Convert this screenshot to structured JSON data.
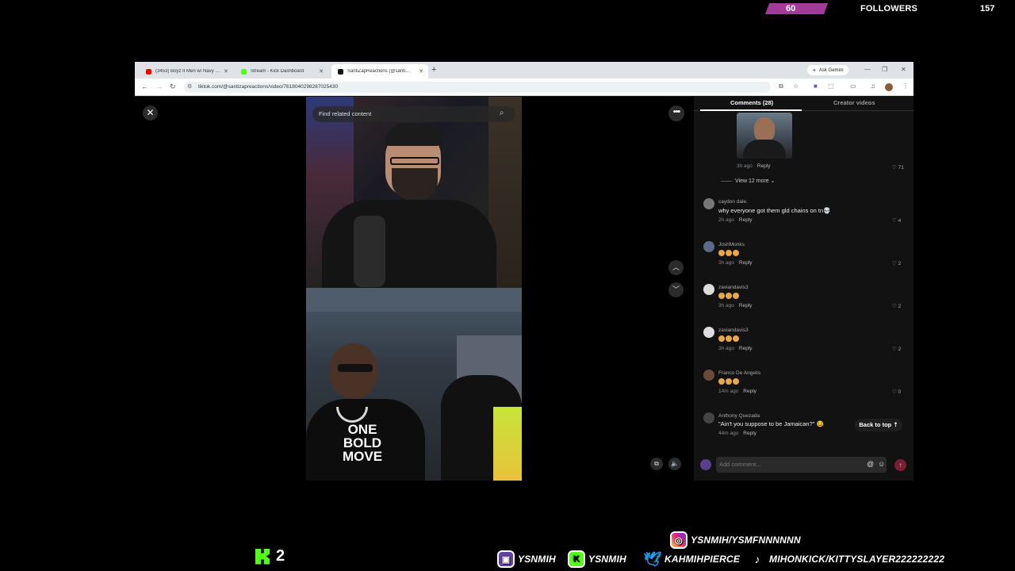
{
  "overlay": {
    "followers_current": "60",
    "followers_label": "FOLLOWERS",
    "followers_goal": "157",
    "followers_progress": 0.38,
    "kick_count": "2",
    "socials": {
      "instagram": "YSNMIH/YSMFNNNNNN",
      "twitch": "YSNMIH",
      "kick": "YSNMIH",
      "twitter": "KAHMIHPIERCE",
      "tiktok": "MIHONKICK/KITTYSLAYER222222222"
    }
  },
  "browser": {
    "tabs": [
      {
        "title": "(3453) Boyz II Men w/ Navy Gr...",
        "favicon_color": "#ff0000",
        "active": false
      },
      {
        "title": "Stream - Kick Dashboard",
        "favicon_color": "#53fc18",
        "active": false
      },
      {
        "title": "SantiZapReactions (@santi...",
        "favicon_color": "#111111",
        "active": true
      }
    ],
    "ask_gemini": "Ask Gemini",
    "url": "tiktok.com/@santizapreactions/video/7618040298287025430"
  },
  "video": {
    "search_placeholder": "Find related content",
    "shirt_text": "ONE BOLD MOVE"
  },
  "comments": {
    "tab_comments": "Comments (28)",
    "tab_creator": "Creator videos",
    "top_reply": {
      "time": "3h ago",
      "reply": "Reply",
      "likes": "71"
    },
    "view_more": "View 12 more",
    "items": [
      {
        "user": "caydon dale.",
        "text": "why everyone got them gld chains on tn💀",
        "time": "2h ago",
        "reply": "Reply",
        "likes": "4"
      },
      {
        "user": "JoshMonks",
        "emoji_count": 3,
        "time": "3h ago",
        "reply": "Reply",
        "likes": "2"
      },
      {
        "user": "zaviandavis3",
        "emoji_count": 3,
        "time": "3h ago",
        "reply": "Reply",
        "likes": "2"
      },
      {
        "user": "zaviandavis3",
        "emoji_count": 3,
        "time": "3h ago",
        "reply": "Reply",
        "likes": "2"
      },
      {
        "user": "Franco De Angelis",
        "emoji_count": 3,
        "time": "14m ago",
        "reply": "Reply",
        "likes": "0"
      },
      {
        "user": "Anthony Quezada",
        "text": "\"Ain't you suppose to be Jamaican?\" 😂",
        "time": "44m ago",
        "reply": "Reply",
        "likes": ""
      }
    ],
    "back_to_top": "Back to top",
    "add_comment_placeholder": "Add comment..."
  }
}
